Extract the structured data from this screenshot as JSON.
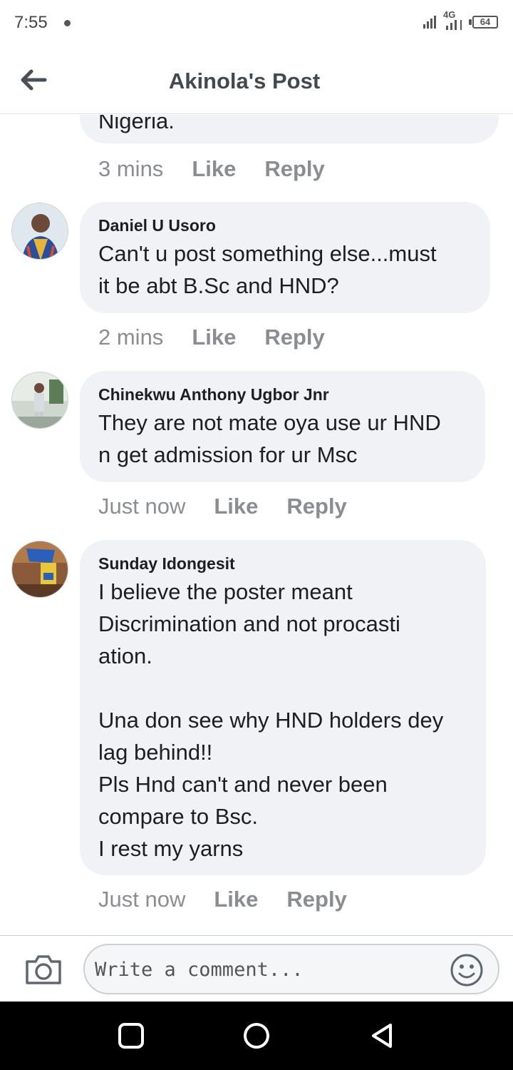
{
  "status_bar": {
    "time": "7:55",
    "network": "4G",
    "battery": "64"
  },
  "header": {
    "title": "Akinola's Post"
  },
  "partial_comment": {
    "text": "Nigeria.",
    "time": "3 mins",
    "like": "Like",
    "reply": "Reply"
  },
  "comments": [
    {
      "author": "Daniel U Usoro",
      "text": "Can't u post something else...must\nit be abt B.Sc and HND?",
      "time": "2 mins",
      "like": "Like",
      "reply": "Reply"
    },
    {
      "author": "Chinekwu Anthony Ugbor Jnr",
      "text": "They are not mate oya use ur HND\nn get admission for ur Msc",
      "time": "Just now",
      "like": "Like",
      "reply": "Reply"
    },
    {
      "author": "Sunday Idongesit",
      "text": "I believe the poster meant\nDiscrimination and not procasti\nation.\n\nUna don see why HND holders dey\nlag behind!!\nPls Hnd can't and never been\ncompare to Bsc.\nI rest my yarns",
      "time": "Just now",
      "like": "Like",
      "reply": "Reply"
    }
  ],
  "composer": {
    "placeholder": "Write a comment..."
  },
  "icons": {
    "back": "back-arrow-icon",
    "camera": "camera-icon",
    "emoji": "smiley-icon",
    "nav_recents": "square-icon",
    "nav_home": "circle-icon",
    "nav_back": "triangle-back-icon"
  },
  "colors": {
    "bubble": "#f0f2f5",
    "meta": "#8a8d91",
    "navbar": "#000000"
  }
}
